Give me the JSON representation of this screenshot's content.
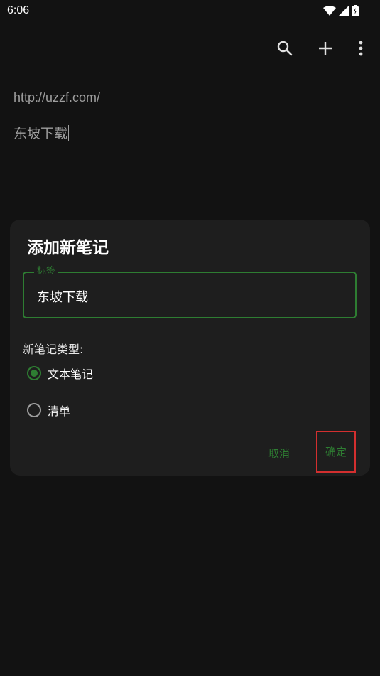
{
  "status_bar": {
    "time": "6:06"
  },
  "toolbar": {
    "icons": [
      "search-icon",
      "add-icon",
      "more-vert-icon"
    ]
  },
  "note": {
    "url": "http://uzzf.com/",
    "body": "东坡下载"
  },
  "dialog": {
    "title": "添加新笔记",
    "label_field": {
      "label": "标签",
      "value": "东坡下载"
    },
    "type_label": "新笔记类型:",
    "options": [
      {
        "label": "文本笔记",
        "selected": true
      },
      {
        "label": "清单",
        "selected": false
      }
    ],
    "cancel_label": "取消",
    "ok_label": "确定"
  },
  "colors": {
    "accent": "#2e7d32",
    "background": "#121212",
    "dialog_bg": "#1e1e1e",
    "highlight_box": "#d32f2f"
  }
}
